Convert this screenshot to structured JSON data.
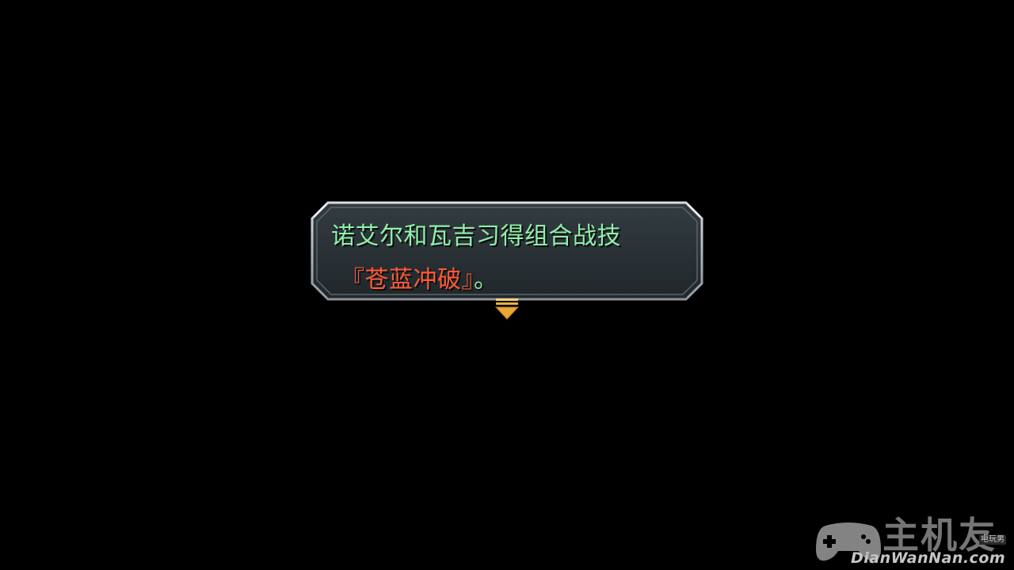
{
  "dialog": {
    "line1": "诺艾尔和瓦吉习得组合战技",
    "skill_open": "『",
    "skill_name": "苍蓝冲破",
    "skill_close": "』",
    "line_end": "。"
  },
  "colors": {
    "text_green": "#8ff0a8",
    "skill_red": "#ff5a36",
    "frame": "#b8bcc2",
    "box_fill": "#2a3236",
    "arrow": "#e8a838"
  },
  "indicator": {
    "icon": "advance-arrow-icon"
  },
  "watermark": {
    "logo_icon": "gamepad-icon",
    "big_text": "主机友",
    "small_text": "电玩男",
    "url": "DianWanNan.com"
  }
}
